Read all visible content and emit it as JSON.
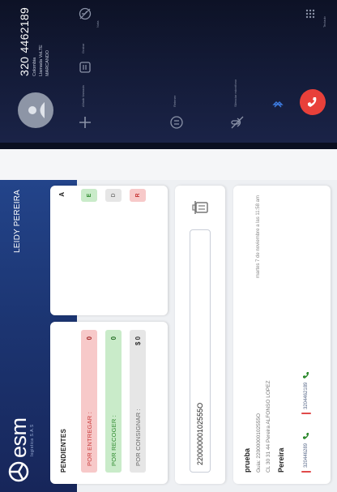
{
  "app": {
    "brand": "esm",
    "brand_sub": "logistica S.A.S",
    "user_name": "LEIDY PEREIRA",
    "pending": {
      "title": "PENDIENTES",
      "rows": [
        {
          "label": "POR ENTREGAR :",
          "value": "0"
        },
        {
          "label": "POR RECOGER :",
          "value": "0"
        },
        {
          "label": "POR CONSIGNAR :",
          "value": "$ 0"
        }
      ]
    },
    "side_card": {
      "heading": "A",
      "chips": [
        "E",
        "D",
        "R"
      ]
    },
    "search": {
      "value": "22000000102555O"
    },
    "order": {
      "name": "prueba",
      "guide": "Guia: 22000000102555O",
      "address": "CL 30 31 44 Pereira ALFONSO LOPEZ",
      "city": "Pereira",
      "timestamp": "martes 7 de noviembre a las 11:58 am",
      "phones": [
        "320446289",
        "3204462189"
      ]
    }
  },
  "call": {
    "number": "320 4462189",
    "country": "Colombia",
    "call_type": "Llamada VoLTE",
    "status": "MARCANDO",
    "controls": {
      "note": "Nota",
      "record": "Grabar",
      "add_call": "Añadir llamada",
      "hold": "Retener",
      "mute": "Silenciar micrófono",
      "keypad": "Teclado"
    },
    "colors": {
      "hangup": "#e8403a",
      "brand_navy": "#1c3572"
    }
  }
}
